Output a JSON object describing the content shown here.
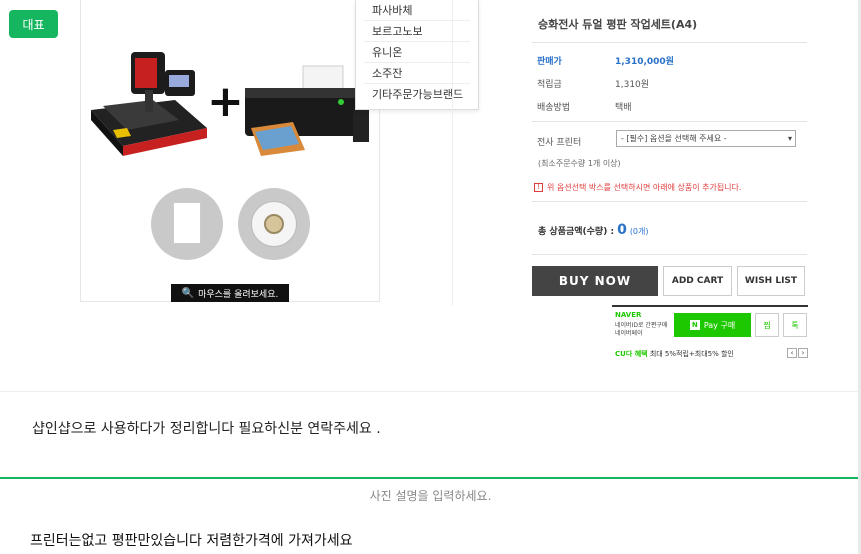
{
  "badge": "대표",
  "dropdown": {
    "items": [
      "파사바체",
      "보르고노보",
      "유니온",
      "소주잔",
      "기타주문가능브랜드"
    ]
  },
  "zoom_hint": "마우스를 올려보세요.",
  "product": {
    "title": "승화전사 듀얼 평판 작업세트(A4)",
    "price_label": "판매가",
    "price_value": "1,310,000원",
    "point_label": "적립금",
    "point_value": "1,310원",
    "ship_label": "배송방법",
    "ship_value": "택배",
    "printer_label": "전사 프린터",
    "printer_select": "- [필수] 옵션을 선택해 주세요 -",
    "min_qty": "(최소주문수량 1개 이상)",
    "notice": "위 옵션선택 박스를 선택하시면 아래에 상품이 추가됩니다.",
    "total_label": "총 상품금액(수량) :",
    "total_value": "0",
    "total_count": "(0개)"
  },
  "buttons": {
    "buy": "BUY NOW",
    "cart": "ADD CART",
    "wish": "WISH LIST"
  },
  "naver": {
    "brand": "NAVER",
    "desc": "네이버ID로 간편구매 네이버페이",
    "pay_label": "Pay 구매",
    "wish_label": "찜",
    "talk_label": "톡",
    "promo_green": "CU다 혜택",
    "promo_text": "최대 5%적립+최대5% 할인"
  },
  "description": {
    "line1": "샵인샵으로 사용하다가  정리합니다 필요하신분 연락주세요 .",
    "caption": "사진 설명을 입력하세요.",
    "line2": "프린터는없고 평판만있습니다 저렴한가격에 가져가세요"
  }
}
